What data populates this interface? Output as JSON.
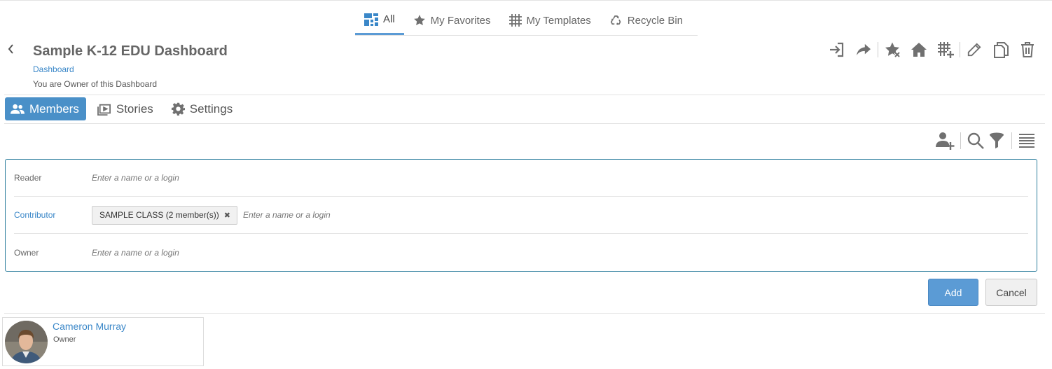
{
  "top_nav": {
    "tabs": [
      {
        "label": "All",
        "icon": "dashboard-grid-icon",
        "active": true
      },
      {
        "label": "My Favorites",
        "icon": "star-icon"
      },
      {
        "label": "My Templates",
        "icon": "template-grid-icon"
      },
      {
        "label": "Recycle Bin",
        "icon": "recycle-icon"
      }
    ]
  },
  "header": {
    "title": "Sample K-12 EDU Dashboard",
    "type_label": "Dashboard",
    "ownership_note": "You are Owner of this Dashboard",
    "actions": [
      "sign-in-icon",
      "share-icon",
      "unfavorite-icon",
      "home-icon",
      "add-template-icon",
      "edit-icon",
      "copy-icon",
      "delete-icon"
    ]
  },
  "sub_tabs": [
    {
      "label": "Members",
      "icon": "users-icon",
      "active": true
    },
    {
      "label": "Stories",
      "icon": "stories-icon"
    },
    {
      "label": "Settings",
      "icon": "gear-icon"
    }
  ],
  "toolbar": [
    "add-user-icon",
    "search-icon",
    "filter-icon",
    "list-view-icon"
  ],
  "members_form": {
    "rows": [
      {
        "role": "Reader",
        "placeholder": "Enter a name or a login",
        "chips": []
      },
      {
        "role": "Contributor",
        "placeholder": "Enter a name or a login",
        "chips": [
          "SAMPLE CLASS (2 member(s))"
        ]
      },
      {
        "role": "Owner",
        "placeholder": "Enter a name or a login",
        "chips": []
      }
    ],
    "add_label": "Add",
    "cancel_label": "Cancel"
  },
  "members": [
    {
      "name": "Cameron Murray",
      "role": "Owner"
    }
  ],
  "colors": {
    "accent": "#4a90c8",
    "link": "#3a87c8",
    "form_border": "#2f7f9e",
    "icon": "#707070"
  }
}
